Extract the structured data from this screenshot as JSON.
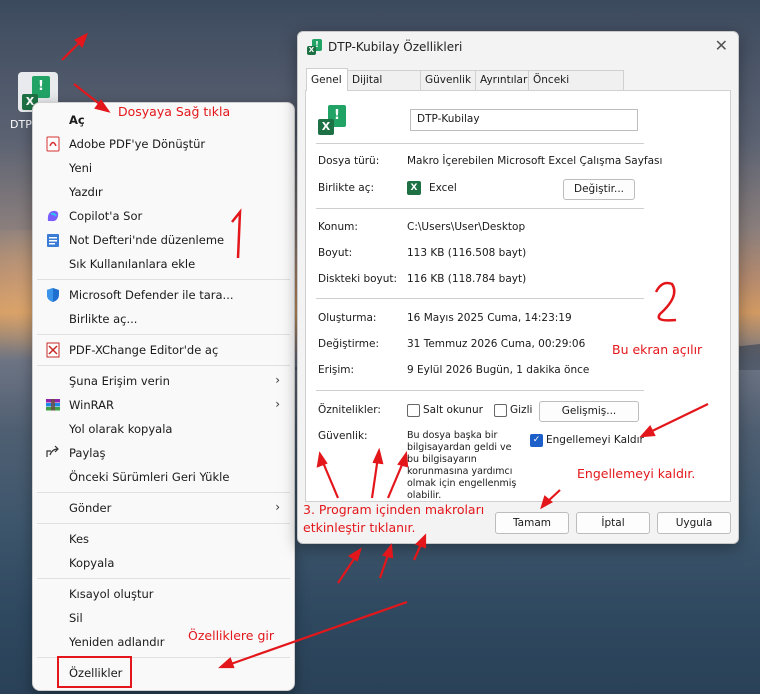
{
  "desktop_icon": {
    "label": "DTP"
  },
  "context_menu": {
    "items": [
      {
        "label": "Aç",
        "icon": "none"
      },
      {
        "label": "Adobe PDF'ye Dönüştür",
        "icon": "adobe-pdf-icon"
      },
      {
        "label": "Yeni",
        "icon": "none"
      },
      {
        "label": "Yazdır",
        "icon": "none"
      },
      {
        "label": "Copilot'a Sor",
        "icon": "copilot-icon"
      },
      {
        "label": "Not Defteri'nde düzenleme",
        "icon": "notepad-icon"
      },
      {
        "label": "Sık Kullanılanlara ekle",
        "icon": "none"
      },
      {
        "label": "Microsoft Defender ile tara...",
        "icon": "defender-shield-icon"
      },
      {
        "label": "Birlikte aç...",
        "icon": "none"
      },
      {
        "label": "PDF-XChange Editor'de aç",
        "icon": "pdf-xchange-icon"
      },
      {
        "label": "Şuna Erişim verin",
        "icon": "none",
        "submenu": true
      },
      {
        "label": "WinRAR",
        "icon": "winrar-icon",
        "submenu": true
      },
      {
        "label": "Yol olarak kopyala",
        "icon": "none"
      },
      {
        "label": "Paylaş",
        "icon": "share-icon"
      },
      {
        "label": "Önceki Sürümleri Geri Yükle",
        "icon": "none"
      },
      {
        "label": "Gönder",
        "icon": "none",
        "submenu": true
      },
      {
        "label": "Kes",
        "icon": "none"
      },
      {
        "label": "Kopyala",
        "icon": "none"
      },
      {
        "label": "Kısayol oluştur",
        "icon": "none"
      },
      {
        "label": "Sil",
        "icon": "none"
      },
      {
        "label": "Yeniden adlandır",
        "icon": "none"
      },
      {
        "label": "Özellikler",
        "icon": "none"
      }
    ],
    "submenu_arrow": "›"
  },
  "dialog": {
    "title": "DTP-Kubilay Özellikleri",
    "close": "✕",
    "tabs": [
      "Genel",
      "Dijital İmzalar",
      "Güvenlik",
      "Ayrıntılar",
      "Önceki Sürümler"
    ],
    "active_tab": "Genel",
    "file_name": "DTP-Kubilay",
    "file_type_label": "Dosya türü:",
    "file_type_value": "Makro İçerebilen Microsoft Excel Çalışma Sayfası",
    "opens_with_label": "Birlikte aç:",
    "opens_with_value": "Excel",
    "change_button": "Değiştir...",
    "location_label": "Konum:",
    "location_value": "C:\\Users\\User\\Desktop",
    "size_label": "Boyut:",
    "size_value": "113 KB (116.508 bayt)",
    "size_on_disk_label": "Diskteki boyut:",
    "size_on_disk_value": "116 KB (118.784 bayt)",
    "created_label": "Oluşturma:",
    "created_value": "16 Mayıs 2025 Cuma, 14:23:19",
    "modified_label": "Değiştirme:",
    "modified_value": "31 Temmuz 2026 Cuma, 00:29:06",
    "accessed_label": "Erişim:",
    "accessed_value": "9 Eylül 2026 Bugün, 1 dakika önce",
    "attributes_label": "Öznitelikler:",
    "readonly_label": "Salt okunur",
    "hidden_label": "Gizli",
    "advanced_button": "Gelişmiş...",
    "security_label": "Güvenlik:",
    "security_text": "Bu dosya başka bir bilgisayardan geldi ve bu bilgisayarın korunmasına yardımcı olmak için engellenmiş olabilir.",
    "unblock_label": "Engellemeyi Kaldır",
    "unblock_checked": true,
    "ok_button": "Tamam",
    "cancel_button": "İptal",
    "apply_button": "Uygula"
  },
  "annotations": {
    "right_click": "Dosyaya Sağ tıkla",
    "step1": "1",
    "step2": "2",
    "screen_opens": "Bu ekran açılır",
    "unblock": "Engellemeyi kaldır.",
    "enable_macros_line1": "3. Program içinden makroları",
    "enable_macros_line2": "etkinleştir tıklanır.",
    "go_properties": "Özelliklere gir"
  }
}
